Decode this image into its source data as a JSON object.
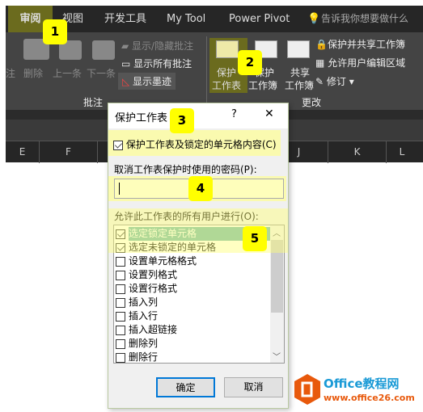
{
  "ribbon": {
    "tabs": [
      {
        "label": "审阅",
        "active": true
      },
      {
        "label": "视图"
      },
      {
        "label": "开发工具"
      },
      {
        "label": "My Tool"
      },
      {
        "label": "Power Pivot"
      }
    ],
    "search_placeholder": "告诉我你想要做什么",
    "comments_group": {
      "label": "批注",
      "items": [
        "注",
        "删除",
        "上一条",
        "下一条"
      ],
      "show_hide": "显示/隐藏批注",
      "show_all": "显示所有批注",
      "show_ink": "显示墨迹"
    },
    "changes_group": {
      "label": "更改",
      "protect_sheet": [
        "保护",
        "工作表"
      ],
      "protect_workbook": [
        "保护",
        "工作簿"
      ],
      "share_workbook": [
        "共享",
        "工作簿"
      ],
      "protect_share": "保护并共享工作簿",
      "allow_edit": "允许用户编辑区域",
      "track_changes": "修订"
    }
  },
  "columns": [
    "E",
    "F",
    "J",
    "K",
    "L"
  ],
  "dialog": {
    "title": "保护工作表",
    "help": "?",
    "close": "✕",
    "protect_checkbox": {
      "label": "保护工作表及锁定的单元格内容(C)",
      "checked": true
    },
    "password_label": "取消工作表保护时使用的密码(P):",
    "password_value": "",
    "allow_label": "允许此工作表的所有用户进行(O):",
    "permissions": [
      {
        "label": "选定锁定单元格",
        "checked": true,
        "selected": true
      },
      {
        "label": "选定未锁定的单元格",
        "checked": true
      },
      {
        "label": "设置单元格格式",
        "checked": false
      },
      {
        "label": "设置列格式",
        "checked": false
      },
      {
        "label": "设置行格式",
        "checked": false
      },
      {
        "label": "插入列",
        "checked": false
      },
      {
        "label": "插入行",
        "checked": false
      },
      {
        "label": "插入超链接",
        "checked": false
      },
      {
        "label": "删除列",
        "checked": false
      },
      {
        "label": "删除行",
        "checked": false
      }
    ],
    "ok": "确定",
    "cancel": "取消"
  },
  "badges": [
    "1",
    "2",
    "3",
    "4",
    "5"
  ],
  "watermark": {
    "brand": "Office教程网",
    "url": "www.office26.com"
  },
  "colors": {
    "highlight": "#ffff00",
    "selection": "#6fb8b0",
    "logo": "#e8590c",
    "brand_text": "#1a9ad6"
  }
}
